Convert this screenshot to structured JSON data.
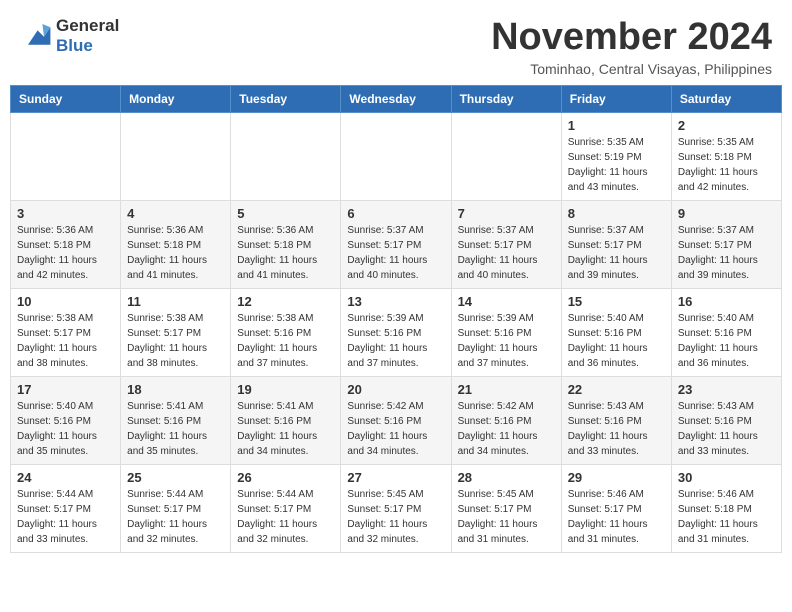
{
  "header": {
    "logo_line1": "General",
    "logo_line2": "Blue",
    "month": "November 2024",
    "location": "Tominhao, Central Visayas, Philippines"
  },
  "weekdays": [
    "Sunday",
    "Monday",
    "Tuesday",
    "Wednesday",
    "Thursday",
    "Friday",
    "Saturday"
  ],
  "rows": [
    [
      {
        "day": "",
        "info": ""
      },
      {
        "day": "",
        "info": ""
      },
      {
        "day": "",
        "info": ""
      },
      {
        "day": "",
        "info": ""
      },
      {
        "day": "",
        "info": ""
      },
      {
        "day": "1",
        "info": "Sunrise: 5:35 AM\nSunset: 5:19 PM\nDaylight: 11 hours and 43 minutes."
      },
      {
        "day": "2",
        "info": "Sunrise: 5:35 AM\nSunset: 5:18 PM\nDaylight: 11 hours and 42 minutes."
      }
    ],
    [
      {
        "day": "3",
        "info": "Sunrise: 5:36 AM\nSunset: 5:18 PM\nDaylight: 11 hours and 42 minutes."
      },
      {
        "day": "4",
        "info": "Sunrise: 5:36 AM\nSunset: 5:18 PM\nDaylight: 11 hours and 41 minutes."
      },
      {
        "day": "5",
        "info": "Sunrise: 5:36 AM\nSunset: 5:18 PM\nDaylight: 11 hours and 41 minutes."
      },
      {
        "day": "6",
        "info": "Sunrise: 5:37 AM\nSunset: 5:17 PM\nDaylight: 11 hours and 40 minutes."
      },
      {
        "day": "7",
        "info": "Sunrise: 5:37 AM\nSunset: 5:17 PM\nDaylight: 11 hours and 40 minutes."
      },
      {
        "day": "8",
        "info": "Sunrise: 5:37 AM\nSunset: 5:17 PM\nDaylight: 11 hours and 39 minutes."
      },
      {
        "day": "9",
        "info": "Sunrise: 5:37 AM\nSunset: 5:17 PM\nDaylight: 11 hours and 39 minutes."
      }
    ],
    [
      {
        "day": "10",
        "info": "Sunrise: 5:38 AM\nSunset: 5:17 PM\nDaylight: 11 hours and 38 minutes."
      },
      {
        "day": "11",
        "info": "Sunrise: 5:38 AM\nSunset: 5:17 PM\nDaylight: 11 hours and 38 minutes."
      },
      {
        "day": "12",
        "info": "Sunrise: 5:38 AM\nSunset: 5:16 PM\nDaylight: 11 hours and 37 minutes."
      },
      {
        "day": "13",
        "info": "Sunrise: 5:39 AM\nSunset: 5:16 PM\nDaylight: 11 hours and 37 minutes."
      },
      {
        "day": "14",
        "info": "Sunrise: 5:39 AM\nSunset: 5:16 PM\nDaylight: 11 hours and 37 minutes."
      },
      {
        "day": "15",
        "info": "Sunrise: 5:40 AM\nSunset: 5:16 PM\nDaylight: 11 hours and 36 minutes."
      },
      {
        "day": "16",
        "info": "Sunrise: 5:40 AM\nSunset: 5:16 PM\nDaylight: 11 hours and 36 minutes."
      }
    ],
    [
      {
        "day": "17",
        "info": "Sunrise: 5:40 AM\nSunset: 5:16 PM\nDaylight: 11 hours and 35 minutes."
      },
      {
        "day": "18",
        "info": "Sunrise: 5:41 AM\nSunset: 5:16 PM\nDaylight: 11 hours and 35 minutes."
      },
      {
        "day": "19",
        "info": "Sunrise: 5:41 AM\nSunset: 5:16 PM\nDaylight: 11 hours and 34 minutes."
      },
      {
        "day": "20",
        "info": "Sunrise: 5:42 AM\nSunset: 5:16 PM\nDaylight: 11 hours and 34 minutes."
      },
      {
        "day": "21",
        "info": "Sunrise: 5:42 AM\nSunset: 5:16 PM\nDaylight: 11 hours and 34 minutes."
      },
      {
        "day": "22",
        "info": "Sunrise: 5:43 AM\nSunset: 5:16 PM\nDaylight: 11 hours and 33 minutes."
      },
      {
        "day": "23",
        "info": "Sunrise: 5:43 AM\nSunset: 5:16 PM\nDaylight: 11 hours and 33 minutes."
      }
    ],
    [
      {
        "day": "24",
        "info": "Sunrise: 5:44 AM\nSunset: 5:17 PM\nDaylight: 11 hours and 33 minutes."
      },
      {
        "day": "25",
        "info": "Sunrise: 5:44 AM\nSunset: 5:17 PM\nDaylight: 11 hours and 32 minutes."
      },
      {
        "day": "26",
        "info": "Sunrise: 5:44 AM\nSunset: 5:17 PM\nDaylight: 11 hours and 32 minutes."
      },
      {
        "day": "27",
        "info": "Sunrise: 5:45 AM\nSunset: 5:17 PM\nDaylight: 11 hours and 32 minutes."
      },
      {
        "day": "28",
        "info": "Sunrise: 5:45 AM\nSunset: 5:17 PM\nDaylight: 11 hours and 31 minutes."
      },
      {
        "day": "29",
        "info": "Sunrise: 5:46 AM\nSunset: 5:17 PM\nDaylight: 11 hours and 31 minutes."
      },
      {
        "day": "30",
        "info": "Sunrise: 5:46 AM\nSunset: 5:18 PM\nDaylight: 11 hours and 31 minutes."
      }
    ]
  ]
}
